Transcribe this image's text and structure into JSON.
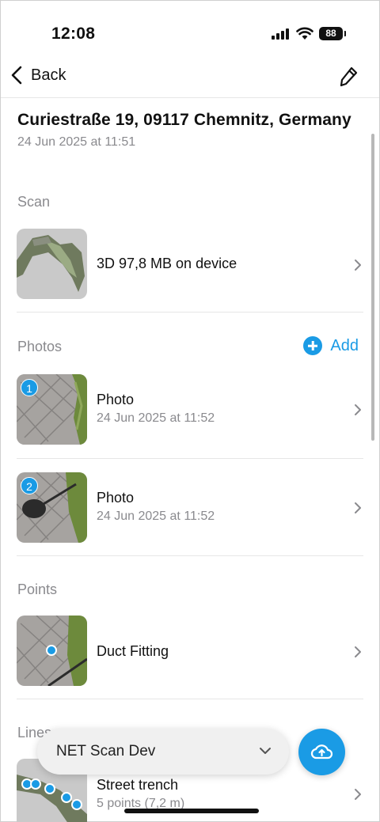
{
  "status_bar": {
    "time": "12:08",
    "battery": "88"
  },
  "nav": {
    "back_label": "Back"
  },
  "header": {
    "title": "Curiestraße 19, 09117 Chemnitz, Germany",
    "date": "24 Jun 2025 at 11:51"
  },
  "scan": {
    "section_label": "Scan",
    "item": {
      "label": "3D 97,8 MB on device"
    }
  },
  "photos": {
    "section_label": "Photos",
    "add_label": "Add",
    "items": [
      {
        "index": "1",
        "title": "Photo",
        "date": "24 Jun 2025 at 11:52"
      },
      {
        "index": "2",
        "title": "Photo",
        "date": "24 Jun 2025 at 11:52"
      }
    ]
  },
  "points": {
    "section_label": "Points",
    "items": [
      {
        "title": "Duct Fitting"
      }
    ]
  },
  "lines": {
    "section_label": "Lines",
    "items": [
      {
        "title": "Street trench",
        "detail": "5 points (7,2 m)"
      }
    ]
  },
  "bottom": {
    "project_selector": "NET Scan Dev"
  },
  "colors": {
    "accent": "#1a9be5",
    "secondary_text": "#8a8a8e",
    "separator": "#e6e6e6"
  }
}
